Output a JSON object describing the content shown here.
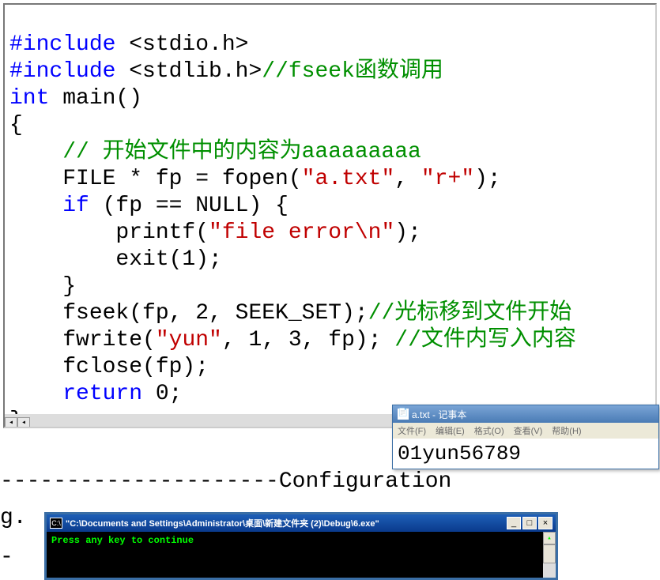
{
  "code": {
    "l1a": "#include",
    "l1b": " <stdio.h>",
    "l2a": "#include",
    "l2b": " <stdlib.h>",
    "l2c": "//fseek函数调用",
    "l3a": "int",
    "l3b": " main()",
    "l4": "{",
    "l5": "    // 开始文件中的内容为aaaaaaaaa",
    "l6a": "    FILE * fp = fopen(",
    "l6b": "\"a.txt\"",
    "l6c": ", ",
    "l6d": "\"r+\"",
    "l6e": ");",
    "l7a": "    ",
    "l7b": "if",
    "l7c": " (fp == NULL) {",
    "l8a": "        printf(",
    "l8b": "\"file error\\n\"",
    "l8c": ");",
    "l9": "        exit(1);",
    "l10": "    }",
    "l11a": "    fseek(fp, 2, SEEK_SET);",
    "l11b": "//光标移到文件开始",
    "l12a": "    fwrite(",
    "l12b": "\"yun\"",
    "l12c": ", 1, 3, fp); ",
    "l12d": "//文件内写入内容",
    "l13": "    fclose(fp);",
    "l14a": "    ",
    "l14b": "return",
    "l14c": " 0;",
    "l15": "}"
  },
  "divider": "---------------------Configuration",
  "prefix_g": "g.",
  "prefix_dash": " -",
  "notepad": {
    "title": "a.txt - 记事本",
    "menu": {
      "file": "文件(F)",
      "edit": "编辑(E)",
      "format": "格式(O)",
      "view": "查看(V)",
      "help": "帮助(H)"
    },
    "content": "01yun56789"
  },
  "console": {
    "icon": "C:\\",
    "title": "\"C:\\Documents and Settings\\Administrator\\桌面\\新建文件夹 (2)\\Debug\\6.exe\"",
    "body": "Press any key to continue",
    "btn_min": "_",
    "btn_max": "□",
    "btn_close": "×"
  },
  "scroll": {
    "left": "◂",
    "right": "▸",
    "up": "▴",
    "down": "▾"
  }
}
